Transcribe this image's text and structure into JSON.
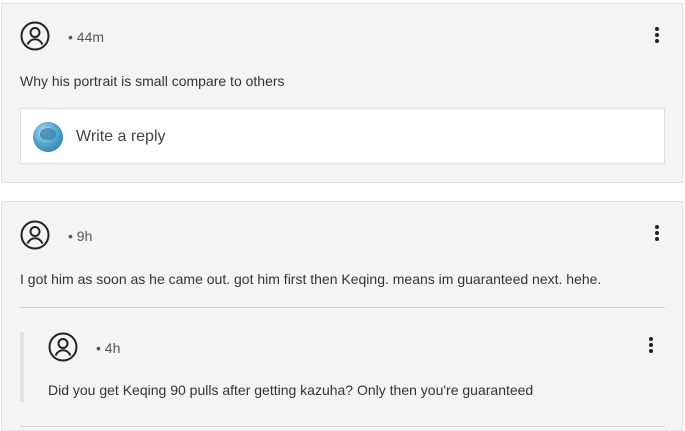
{
  "comments": [
    {
      "time": "• 44m",
      "text": "Why his portrait is small compare to others",
      "reply_placeholder": "Write a reply"
    },
    {
      "time": "• 9h",
      "text": "I got him as soon as he came out. got him first then Keqing. means im guaranteed next. hehe.",
      "replies": [
        {
          "time": "• 4h",
          "text": "Did you get Keqing 90 pulls after getting kazuha? Only then you're guaranteed"
        }
      ]
    }
  ],
  "icons": {
    "avatar": "user-circle-icon",
    "menu": "more-vertical-icon"
  }
}
